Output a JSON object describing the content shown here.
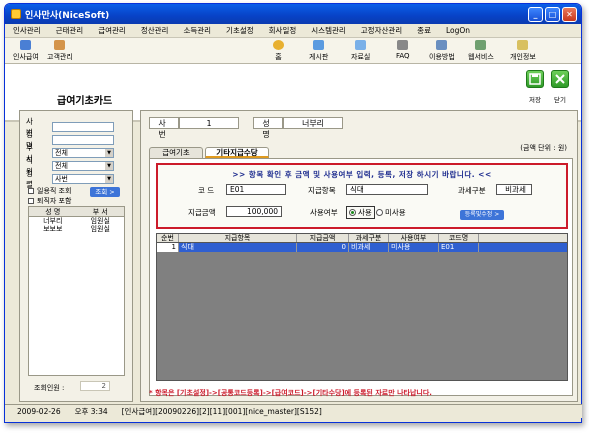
{
  "window": {
    "title": "인사만사(NiceSoft)"
  },
  "menu": [
    "인사관리",
    "근태관리",
    "급여관리",
    "정산관리",
    "소득관리",
    "기초설정",
    "회사일정",
    "시스템관리",
    "고정자산관리",
    "종료",
    "LogOn"
  ],
  "toolbar_left": [
    "인사급여",
    "고객관리"
  ],
  "toolbar_right": [
    "홈",
    "게시판",
    "자료실",
    "FAQ",
    "이용방법",
    "웹서비스",
    "개인정보"
  ],
  "page_title": "급여기초카드",
  "actions": {
    "save": "저장",
    "close": "닫기"
  },
  "search": {
    "labels": [
      "사 번",
      "성 명",
      "부 서",
      "직 위",
      "정 렬"
    ],
    "dept_value": "전체",
    "position_value": "전체",
    "sort_value": "사번",
    "check1": "일용직 조회",
    "check2": "퇴직자 포함",
    "lookup": "조회 >"
  },
  "emp_list": {
    "headers": [
      "성 명",
      "부 서"
    ],
    "rows": [
      [
        "너부리",
        "임원실"
      ],
      [
        "보보보",
        "임원실"
      ]
    ]
  },
  "count": {
    "label": "조회인원 :",
    "value": "2"
  },
  "employee": {
    "id_label": "사 번",
    "id_value": "1",
    "name_label": "성 명",
    "name_value": "너부리"
  },
  "unit": "(금액 단위 : 원)",
  "tabs": [
    "급여기초",
    "기타지급수당"
  ],
  "form": {
    "notice": ">>  항목 확인 후 금액 및 사용여부 입력, 등록, 저장 하시기 바랍니다.  <<",
    "code_label": "코 드",
    "code_value": "E01",
    "item_label": "지급항목",
    "item_value": "식대",
    "tax_label": "과세구분",
    "tax_value": "비과세",
    "amount_label": "지급금액",
    "amount_value": "100,000",
    "use_label": "사용여부",
    "use_yes": "사용",
    "use_no": "미사용",
    "register": "등록및수정 >"
  },
  "grid": {
    "headers": [
      "순번",
      "지급항목",
      "지급금액",
      "과세구분",
      "사용여부",
      "코드명"
    ],
    "rows": [
      [
        "1",
        "식대",
        "0",
        "비과세",
        "미사용",
        "E01"
      ]
    ]
  },
  "footer_note": "* 항목은 [기초설정]->[공통코드등록]->[급여코드]->[기타수당]에 등록된 자료만 나타납니다.",
  "status": [
    "2009-02-26",
    "오후 3:34",
    "[인사급여][20090226][2][11][001][nice_master][S152]"
  ]
}
